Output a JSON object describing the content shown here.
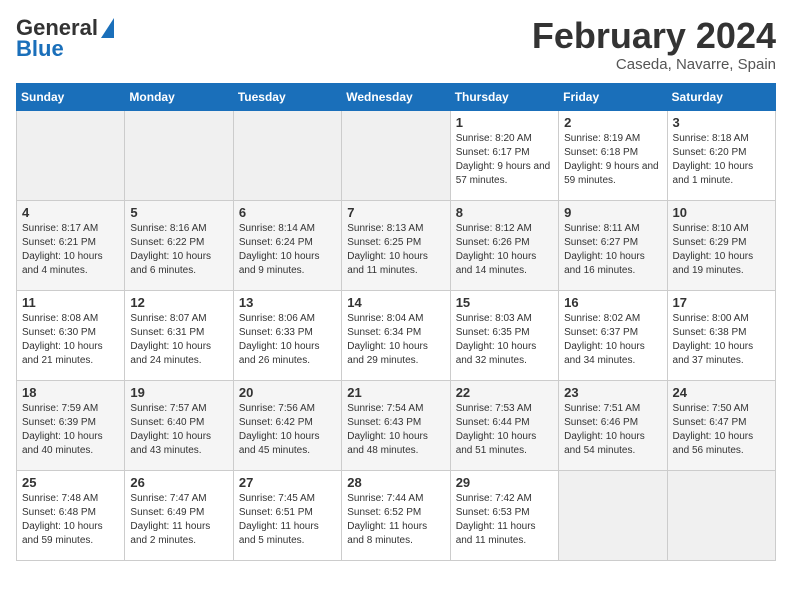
{
  "header": {
    "logo_line1": "General",
    "logo_line2": "Blue",
    "month_title": "February 2024",
    "location": "Caseda, Navarre, Spain"
  },
  "weekdays": [
    "Sunday",
    "Monday",
    "Tuesday",
    "Wednesday",
    "Thursday",
    "Friday",
    "Saturday"
  ],
  "weeks": [
    [
      {
        "day": "",
        "sunrise": "",
        "sunset": "",
        "daylight": "",
        "empty": true
      },
      {
        "day": "",
        "sunrise": "",
        "sunset": "",
        "daylight": "",
        "empty": true
      },
      {
        "day": "",
        "sunrise": "",
        "sunset": "",
        "daylight": "",
        "empty": true
      },
      {
        "day": "",
        "sunrise": "",
        "sunset": "",
        "daylight": "",
        "empty": true
      },
      {
        "day": "1",
        "sunrise": "Sunrise: 8:20 AM",
        "sunset": "Sunset: 6:17 PM",
        "daylight": "Daylight: 9 hours and 57 minutes."
      },
      {
        "day": "2",
        "sunrise": "Sunrise: 8:19 AM",
        "sunset": "Sunset: 6:18 PM",
        "daylight": "Daylight: 9 hours and 59 minutes."
      },
      {
        "day": "3",
        "sunrise": "Sunrise: 8:18 AM",
        "sunset": "Sunset: 6:20 PM",
        "daylight": "Daylight: 10 hours and 1 minute."
      }
    ],
    [
      {
        "day": "4",
        "sunrise": "Sunrise: 8:17 AM",
        "sunset": "Sunset: 6:21 PM",
        "daylight": "Daylight: 10 hours and 4 minutes."
      },
      {
        "day": "5",
        "sunrise": "Sunrise: 8:16 AM",
        "sunset": "Sunset: 6:22 PM",
        "daylight": "Daylight: 10 hours and 6 minutes."
      },
      {
        "day": "6",
        "sunrise": "Sunrise: 8:14 AM",
        "sunset": "Sunset: 6:24 PM",
        "daylight": "Daylight: 10 hours and 9 minutes."
      },
      {
        "day": "7",
        "sunrise": "Sunrise: 8:13 AM",
        "sunset": "Sunset: 6:25 PM",
        "daylight": "Daylight: 10 hours and 11 minutes."
      },
      {
        "day": "8",
        "sunrise": "Sunrise: 8:12 AM",
        "sunset": "Sunset: 6:26 PM",
        "daylight": "Daylight: 10 hours and 14 minutes."
      },
      {
        "day": "9",
        "sunrise": "Sunrise: 8:11 AM",
        "sunset": "Sunset: 6:27 PM",
        "daylight": "Daylight: 10 hours and 16 minutes."
      },
      {
        "day": "10",
        "sunrise": "Sunrise: 8:10 AM",
        "sunset": "Sunset: 6:29 PM",
        "daylight": "Daylight: 10 hours and 19 minutes."
      }
    ],
    [
      {
        "day": "11",
        "sunrise": "Sunrise: 8:08 AM",
        "sunset": "Sunset: 6:30 PM",
        "daylight": "Daylight: 10 hours and 21 minutes."
      },
      {
        "day": "12",
        "sunrise": "Sunrise: 8:07 AM",
        "sunset": "Sunset: 6:31 PM",
        "daylight": "Daylight: 10 hours and 24 minutes."
      },
      {
        "day": "13",
        "sunrise": "Sunrise: 8:06 AM",
        "sunset": "Sunset: 6:33 PM",
        "daylight": "Daylight: 10 hours and 26 minutes."
      },
      {
        "day": "14",
        "sunrise": "Sunrise: 8:04 AM",
        "sunset": "Sunset: 6:34 PM",
        "daylight": "Daylight: 10 hours and 29 minutes."
      },
      {
        "day": "15",
        "sunrise": "Sunrise: 8:03 AM",
        "sunset": "Sunset: 6:35 PM",
        "daylight": "Daylight: 10 hours and 32 minutes."
      },
      {
        "day": "16",
        "sunrise": "Sunrise: 8:02 AM",
        "sunset": "Sunset: 6:37 PM",
        "daylight": "Daylight: 10 hours and 34 minutes."
      },
      {
        "day": "17",
        "sunrise": "Sunrise: 8:00 AM",
        "sunset": "Sunset: 6:38 PM",
        "daylight": "Daylight: 10 hours and 37 minutes."
      }
    ],
    [
      {
        "day": "18",
        "sunrise": "Sunrise: 7:59 AM",
        "sunset": "Sunset: 6:39 PM",
        "daylight": "Daylight: 10 hours and 40 minutes."
      },
      {
        "day": "19",
        "sunrise": "Sunrise: 7:57 AM",
        "sunset": "Sunset: 6:40 PM",
        "daylight": "Daylight: 10 hours and 43 minutes."
      },
      {
        "day": "20",
        "sunrise": "Sunrise: 7:56 AM",
        "sunset": "Sunset: 6:42 PM",
        "daylight": "Daylight: 10 hours and 45 minutes."
      },
      {
        "day": "21",
        "sunrise": "Sunrise: 7:54 AM",
        "sunset": "Sunset: 6:43 PM",
        "daylight": "Daylight: 10 hours and 48 minutes."
      },
      {
        "day": "22",
        "sunrise": "Sunrise: 7:53 AM",
        "sunset": "Sunset: 6:44 PM",
        "daylight": "Daylight: 10 hours and 51 minutes."
      },
      {
        "day": "23",
        "sunrise": "Sunrise: 7:51 AM",
        "sunset": "Sunset: 6:46 PM",
        "daylight": "Daylight: 10 hours and 54 minutes."
      },
      {
        "day": "24",
        "sunrise": "Sunrise: 7:50 AM",
        "sunset": "Sunset: 6:47 PM",
        "daylight": "Daylight: 10 hours and 56 minutes."
      }
    ],
    [
      {
        "day": "25",
        "sunrise": "Sunrise: 7:48 AM",
        "sunset": "Sunset: 6:48 PM",
        "daylight": "Daylight: 10 hours and 59 minutes."
      },
      {
        "day": "26",
        "sunrise": "Sunrise: 7:47 AM",
        "sunset": "Sunset: 6:49 PM",
        "daylight": "Daylight: 11 hours and 2 minutes."
      },
      {
        "day": "27",
        "sunrise": "Sunrise: 7:45 AM",
        "sunset": "Sunset: 6:51 PM",
        "daylight": "Daylight: 11 hours and 5 minutes."
      },
      {
        "day": "28",
        "sunrise": "Sunrise: 7:44 AM",
        "sunset": "Sunset: 6:52 PM",
        "daylight": "Daylight: 11 hours and 8 minutes."
      },
      {
        "day": "29",
        "sunrise": "Sunrise: 7:42 AM",
        "sunset": "Sunset: 6:53 PM",
        "daylight": "Daylight: 11 hours and 11 minutes."
      },
      {
        "day": "",
        "sunrise": "",
        "sunset": "",
        "daylight": "",
        "empty": true
      },
      {
        "day": "",
        "sunrise": "",
        "sunset": "",
        "daylight": "",
        "empty": true
      }
    ]
  ]
}
